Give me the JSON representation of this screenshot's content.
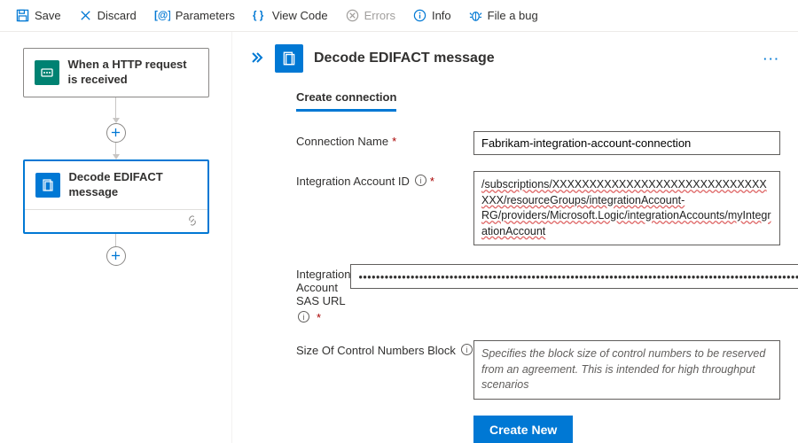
{
  "toolbar": {
    "save": "Save",
    "discard": "Discard",
    "parameters": "Parameters",
    "view_code": "View Code",
    "errors": "Errors",
    "info": "Info",
    "file_bug": "File a bug"
  },
  "canvas": {
    "node1": {
      "title": "When a HTTP request is received"
    },
    "node2": {
      "title": "Decode EDIFACT message"
    }
  },
  "panel": {
    "title": "Decode EDIFACT message",
    "tab": "Create connection",
    "fields": {
      "conn_name": {
        "label": "Connection Name",
        "value": "Fabrikam-integration-account-connection"
      },
      "acct_id": {
        "label": "Integration Account ID",
        "value": "/subscriptions/XXXXXXXXXXXXXXXXXXXXXXXXXXXXXXXX/resourceGroups/integrationAccount-RG/providers/Microsoft.Logic/integrationAccounts/myIntegrationAccount"
      },
      "sas_url": {
        "label": "Integration Account SAS URL",
        "value": "•••••••••••••••••••••••••••••••••••••••••••••••••••••••••••••••••••••••••••••••••••••••••••••••••••••••••••••••••••••"
      },
      "block_size": {
        "label": "Size Of Control Numbers Block",
        "placeholder": "Specifies the block size of control numbers to be reserved from an agreement. This is intended for high throughput scenarios"
      }
    },
    "button": "Create New"
  }
}
